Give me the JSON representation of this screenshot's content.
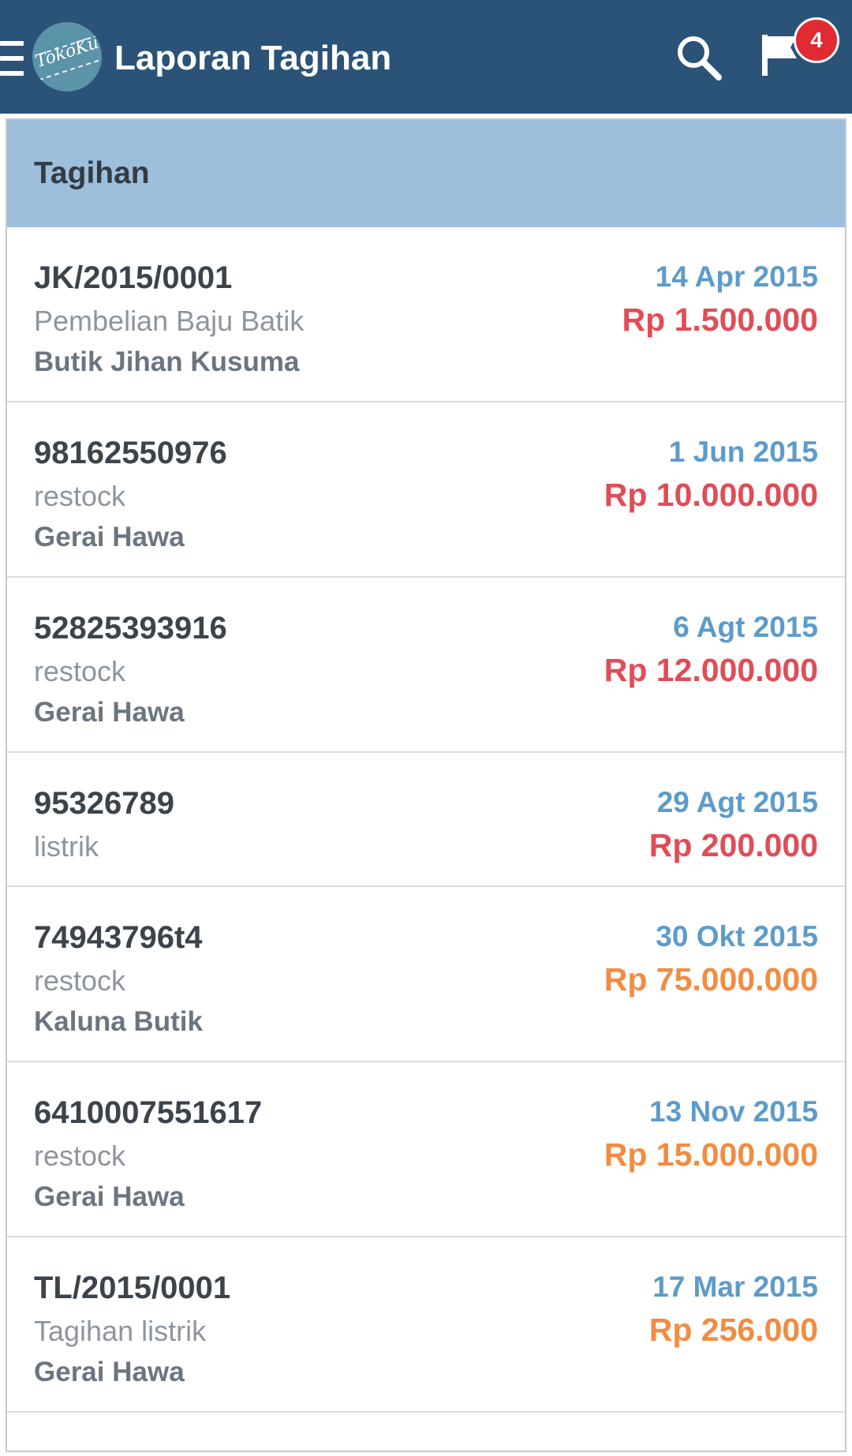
{
  "appbar": {
    "title": "Laporan Tagihan",
    "logo_text": "TokoKu",
    "notification_count": "4",
    "icons": {
      "menu": "hamburger-menu-icon",
      "search": "search-icon",
      "flag": "flag-icon"
    },
    "color": "#2b5377"
  },
  "panel": {
    "title": "Tagihan",
    "header_color": "#9dbfdc"
  },
  "bills": [
    {
      "id": "JK/2015/0001",
      "description": "Pembelian Baju Batik",
      "vendor": "Butik Jihan Kusuma",
      "date": "14 Apr 2015",
      "amount": "Rp 1.500.000",
      "amount_color": "#e04d56"
    },
    {
      "id": "98162550976",
      "description": "restock",
      "vendor": "Gerai Hawa",
      "date": "1 Jun 2015",
      "amount": "Rp 10.000.000",
      "amount_color": "#e04d56"
    },
    {
      "id": "52825393916",
      "description": "restock",
      "vendor": "Gerai Hawa",
      "date": "6 Agt 2015",
      "amount": "Rp 12.000.000",
      "amount_color": "#e04d56"
    },
    {
      "id": "95326789",
      "description": "listrik",
      "vendor": "",
      "date": "29 Agt 2015",
      "amount": "Rp 200.000",
      "amount_color": "#e04d56"
    },
    {
      "id": "74943796t4",
      "description": "restock",
      "vendor": "Kaluna Butik",
      "date": "30 Okt 2015",
      "amount": "Rp 75.000.000",
      "amount_color": "#f28c43"
    },
    {
      "id": "6410007551617",
      "description": "restock",
      "vendor": "Gerai Hawa",
      "date": "13 Nov 2015",
      "amount": "Rp 15.000.000",
      "amount_color": "#f28c43"
    },
    {
      "id": "TL/2015/0001",
      "description": "Tagihan listrik",
      "vendor": "Gerai Hawa",
      "date": "17 Mar 2015",
      "amount": "Rp 256.000",
      "amount_color": "#f28c43"
    }
  ]
}
